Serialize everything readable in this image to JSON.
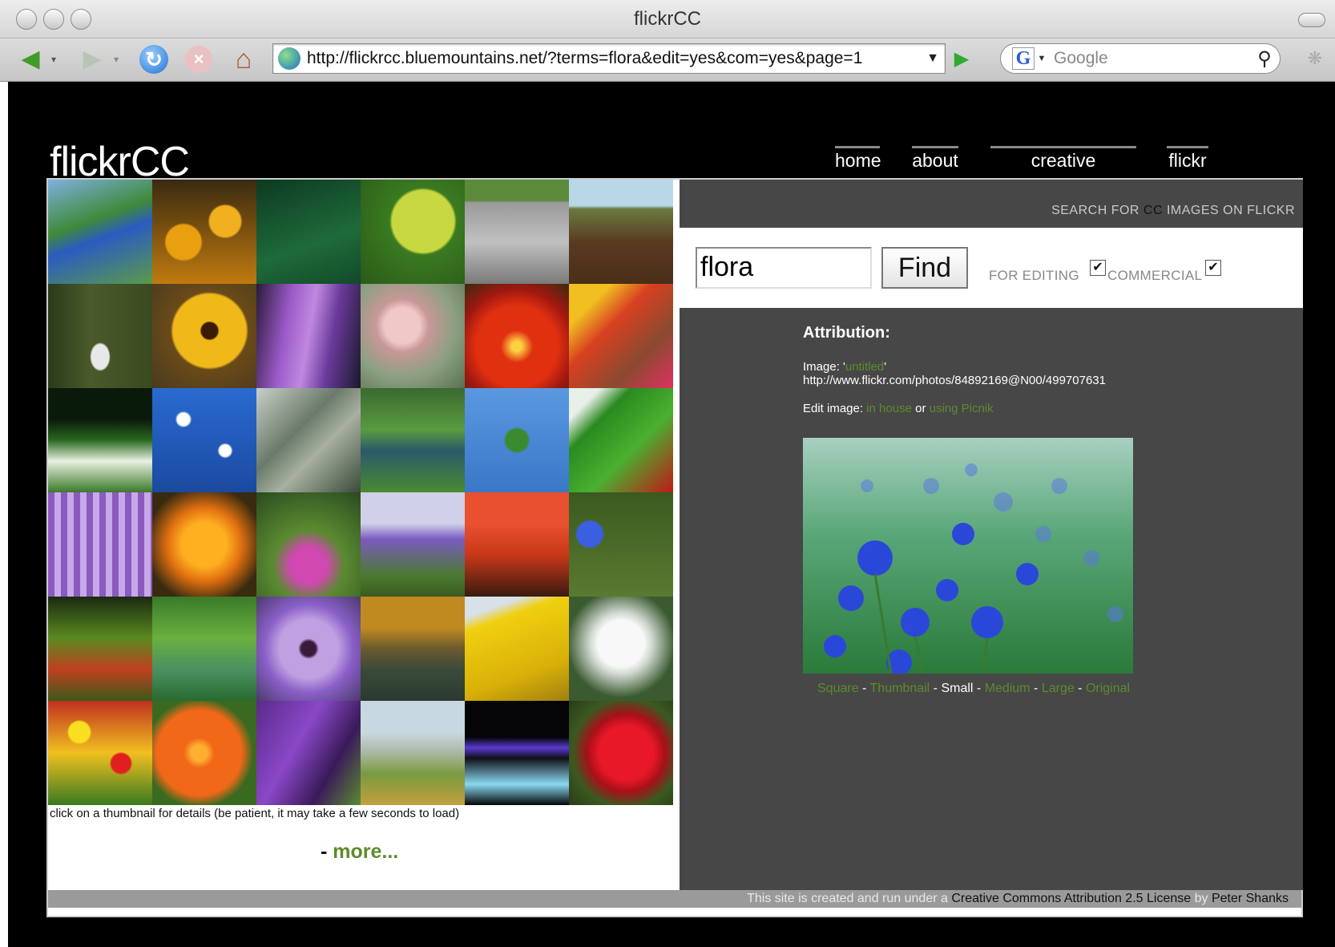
{
  "window": {
    "title": "flickrCC"
  },
  "toolbar": {
    "url": "http://flickrcc.bluemountains.net/?terms=flora&edit=yes&com=yes&page=1",
    "search_placeholder": "Google",
    "search_engine_glyph": "G"
  },
  "site": {
    "logo": "flickrCC",
    "nav": [
      "home",
      "about",
      "creative commons",
      "flickr"
    ]
  },
  "panel": {
    "header_prefix": "SEARCH FOR ",
    "header_cc": "CC",
    "header_suffix": " IMAGES ON FLICKR",
    "query": "flora",
    "find_label": "Find",
    "for_editing_label": "FOR EDITING",
    "commercial_label": "COMMERCIAL",
    "for_editing_checked": true,
    "commercial_checked": true
  },
  "attribution": {
    "title": "Attribution:",
    "image_prefix": "Image: '",
    "image_title": "untitled",
    "image_suffix": "'",
    "image_url": "http://www.flickr.com/photos/84892169@N00/499707631",
    "edit_prefix": "Edit image: ",
    "edit_in_house": "in house",
    "edit_or": " or ",
    "edit_picnik": "using Picnik"
  },
  "sizes": {
    "square": "Square",
    "thumbnail": "Thumbnail",
    "small": "Small",
    "medium": "Medium",
    "large": "Large",
    "original": "Original",
    "sep": " - "
  },
  "gallery": {
    "caption": "click on a thumbnail for details (be patient, it may take a few seconds to load)",
    "more_prefix": "- ",
    "more_link": "more..."
  },
  "footer": {
    "text": "This site is created and run under a ",
    "license": "Creative Commons Attribution 2.5 License",
    "by": " by ",
    "author": "Peter Shanks"
  },
  "colors": {
    "link_green": "#5c8c2c",
    "panel_gray": "#474747",
    "footer_gray": "#9a9a9a",
    "page_black": "#000000"
  },
  "thumbnails": [
    {
      "bg": "linear-gradient(160deg,#7fb0e0 0%,#3e8a3a 40%,#2a5cc0 55%,#5a9a4a 100%)"
    },
    {
      "bg": "radial-gradient(circle at 30% 60%,#e8a010 0 18%,transparent 20%),radial-gradient(circle at 70% 40%,#f0b020 0 16%,transparent 18%),linear-gradient(#3a2a10,#c07a10)"
    },
    {
      "bg": "linear-gradient(160deg,#0d3a22,#1e6a3a 60%,#124a2a)"
    },
    {
      "bg": "radial-gradient(circle at 60% 40%,#c8d840 0 35%,#3a7a20 38%,#2a5a18 100%)"
    },
    {
      "bg": "linear-gradient(#5a8a3a 0 20%,#9a9a9a 22%,#c0c0c0 60%,#7a7a7a 100%)"
    },
    {
      "bg": "linear-gradient(#b8d8e8 0 25%,#6a7a40 28%,#5a3a20 60%,#4a2e18 100%)"
    },
    {
      "bg": "radial-gradient(ellipse at 50% 70%,#e8e8e8 0 12%,transparent 14%),linear-gradient(90deg,#2a3a1a,#4a5a2a 40%,#3a4a20)"
    },
    {
      "bg": "radial-gradient(circle at 55% 45%,#3a1a00 0 10%,#f0b818 12% 45%,#6a4a18 48%,#4a3a20 100%)"
    },
    {
      "bg": "linear-gradient(100deg,#2a1a3a,#9a5ac8 30%,#c088e0 50%,#6a3a9a 70%,#1a1a2a)"
    },
    {
      "bg": "radial-gradient(circle at 40% 40%,#f0c8c8 0 20%,#c89898 30%,#8aa080 60%,#5a7050)"
    },
    {
      "bg": "radial-gradient(circle at 50% 60%,#ffd040 0 6%,#e03010 20% 50%,#a01810 70%,#3a2a10)"
    },
    {
      "bg": "linear-gradient(135deg,#f0c020 0 20%,#d84020 40%,#8a4a30 70%,#e03060 100%)"
    },
    {
      "bg": "linear-gradient(#0a1a0a 0 30%,#2a6a20 50%,#e8f0e0 70%,#3a7a28 100%)"
    },
    {
      "bg": "radial-gradient(circle at 30% 30%,#fff 0 6%,transparent 8%),radial-gradient(circle at 70% 60%,#fff 0 6%,transparent 8%),linear-gradient(#2a6ad0,#1a4aa0)"
    },
    {
      "bg": "linear-gradient(135deg,#c8d0c8,#6a7a6a 40%,#a8b0a0 60%,#3a4a3a)"
    },
    {
      "bg": "linear-gradient(#3a6a30,#5a9a40 40%,#2a5a6a 60%,#4a8a30)"
    },
    {
      "bg": "radial-gradient(ellipse at 50% 50%,#3a8a30 0 15%,transparent 18%),linear-gradient(#5a98e0,#3a78c8)"
    },
    {
      "bg": "linear-gradient(135deg,#e8f0e8 0 15%,#2a8a20 30%,#4ab030 60%,#c01818 100%)"
    },
    {
      "bg": "repeating-linear-gradient(90deg,#8a5ac0 0 8px,#c8a8e8 8px 16px)"
    },
    {
      "bg": "radial-gradient(circle at 50% 50%,#ffb020 0 30%,#e07010 50%,#3a2a10 80%)"
    },
    {
      "bg": "radial-gradient(circle at 50% 70%,#d048b0 0 20%,#5a8a30 40%,#2a4a20)"
    },
    {
      "bg": "linear-gradient(#d0d0e8 0 30%,#7a5ac0 45%,#4a7a30 80%,#3a5a20)"
    },
    {
      "bg": "linear-gradient(#e85030 0 30%,#c83818 60%,#3a1a10 100%)"
    },
    {
      "bg": "radial-gradient(circle at 20% 40%,#3a60e0 0 12%,transparent 14%),linear-gradient(#3a5a20,#5a7a30)"
    },
    {
      "bg": "linear-gradient(#1a2a10,#5a8a20 40%,#c04020 70%,#3a5a18)"
    },
    {
      "bg": "linear-gradient(#3a7a2a,#6ab040 40%,#4a9060 70%,#2a6a30)"
    },
    {
      "bg": "radial-gradient(circle at 50% 50%,#3a1a3a 0 10%,#c0a0e0 14% 40%,#8a60c8 60%,#4a3a6a)"
    },
    {
      "bg": "linear-gradient(#c08a20 0 30%,#6a5a30 50%,#3a4a3a 70%,#2a3a30)"
    },
    {
      "bg": "linear-gradient(160deg,#d8e0e8 0 15%,#f0d010 25%,#d8b008 70%,#a08010)"
    },
    {
      "bg": "radial-gradient(circle at 50% 45%,#f8f8f8 0 30%,#d0d8d0 40%,#3a5a30 70%)"
    },
    {
      "bg": "radial-gradient(circle at 30% 30%,#f8e020 0 10%,transparent 12%),radial-gradient(circle at 70% 60%,#e02020 0 10%,transparent 12%),linear-gradient(#c03020,#f0c020 50%,#3a7a20)"
    },
    {
      "bg": "radial-gradient(circle at 45% 50%,#ffb030 0 10%,#f06818 20% 55%,#3a6a20 70%)"
    },
    {
      "bg": "linear-gradient(120deg,#5a2a8a,#8a48c8 40%,#3a1a5a 70%,#5a8a30)"
    },
    {
      "bg": "linear-gradient(#c8d8e0 0 30%,#a8b8a0 50%,#7a9a40 70%,#c0a040)"
    },
    {
      "bg": "linear-gradient(#050508 0 35%,#5a3ad0 45%,#101018 55%,#8ad8f0 80%,#050508)"
    },
    {
      "bg": "radial-gradient(circle at 55% 50%,#e81828 0 35%,#a81018 50%,#3a5a20 70%,#2a3a18)"
    }
  ]
}
